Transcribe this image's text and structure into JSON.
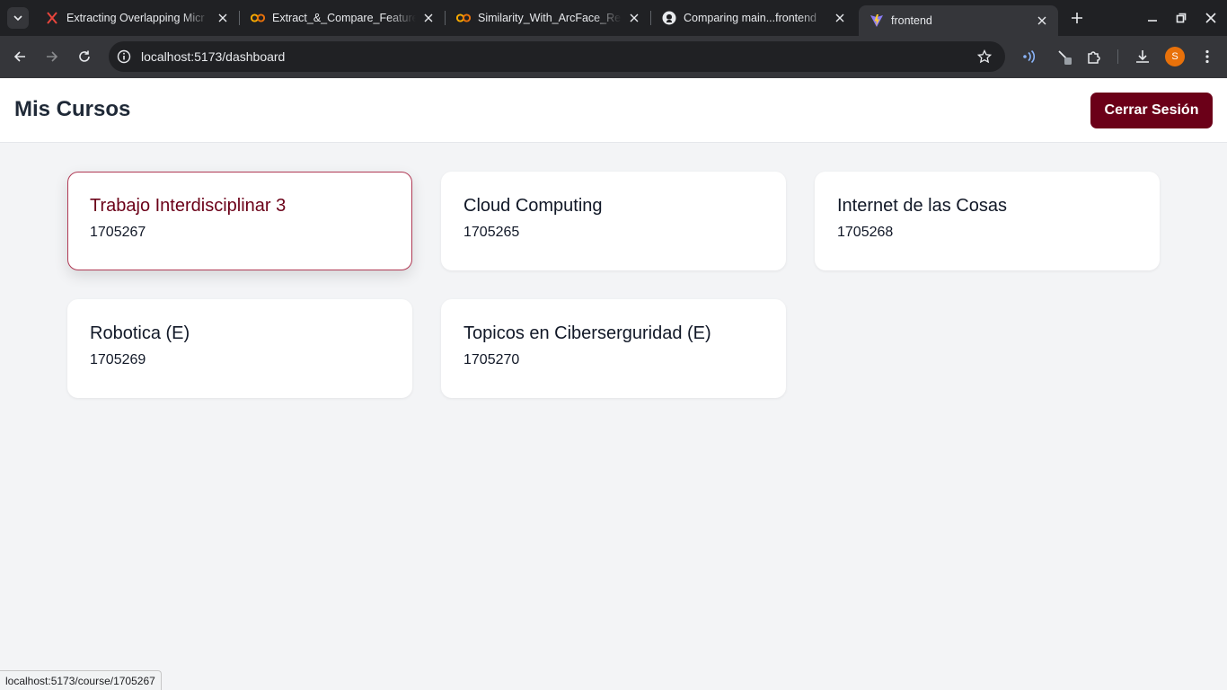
{
  "browser": {
    "tabs": [
      {
        "title": "Extracting Overlapping Micr",
        "icon": "x-logo-icon"
      },
      {
        "title": "Extract_&_Compare_Feature",
        "icon": "colab-icon"
      },
      {
        "title": "Similarity_With_ArcFace_Res",
        "icon": "colab-icon"
      },
      {
        "title": "Comparing main...frontend",
        "icon": "github-icon"
      },
      {
        "title": "frontend",
        "icon": "vite-icon",
        "active": true
      }
    ],
    "url": "localhost:5173/dashboard",
    "profile_initial": "S",
    "status_url": "localhost:5173/course/1705267"
  },
  "header": {
    "title": "Mis Cursos",
    "logout_label": "Cerrar Sesión"
  },
  "courses": [
    {
      "name": "Trabajo Interdisciplinar 3",
      "code": "1705267"
    },
    {
      "name": "Cloud Computing",
      "code": "1705265"
    },
    {
      "name": "Internet de las Cosas",
      "code": "1705268"
    },
    {
      "name": "Robotica (E)",
      "code": "1705269"
    },
    {
      "name": "Topicos en Ciberserguridad (E)",
      "code": "1705270"
    }
  ],
  "colors": {
    "accent": "#6b0018",
    "background": "#f3f4f6"
  }
}
